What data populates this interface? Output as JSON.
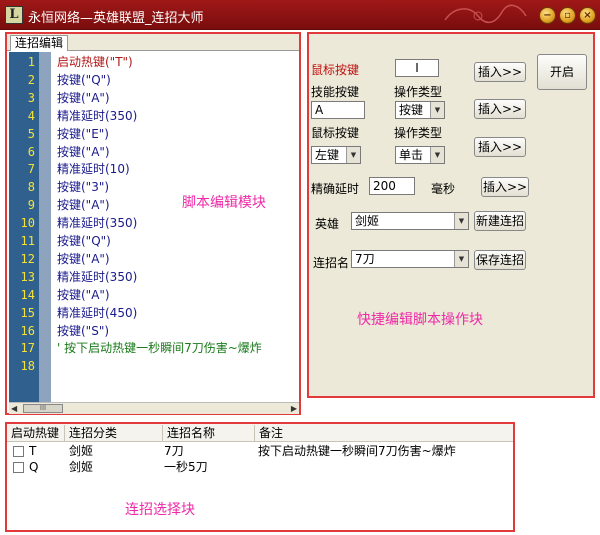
{
  "window": {
    "logo_letter": "L",
    "title": "永恒网络—英雄联盟_连招大师",
    "minimize_glyph": "−",
    "maximize_glyph": "▫",
    "close_glyph": "×",
    "titlebar_color": "#8f1212"
  },
  "editor": {
    "tab_label": "连招编辑",
    "annotation": "脚本编辑模块",
    "line_numbers": [
      "1",
      "2",
      "3",
      "4",
      "5",
      "6",
      "7",
      "8",
      "9",
      "10",
      "11",
      "12",
      "13",
      "14",
      "15",
      "16",
      "17",
      "18"
    ],
    "lines": [
      "启动热键(\"T\")",
      "按键(\"Q\")",
      "按键(\"A\")",
      "精准延时(350)",
      "按键(\"E\")",
      "按键(\"A\")",
      "精准延时(10)",
      "按键(\"3\")",
      "按键(\"A\")",
      "精准延时(350)",
      "按键(\"Q\")",
      "按键(\"A\")",
      "精准延时(350)",
      "按键(\"A\")",
      "精准延时(450)",
      "按键(\"S\")",
      "' 按下启动热键一秒瞬间7刀伤害~爆炸",
      ""
    ],
    "scroll_left": "◀",
    "scroll_right": "▶",
    "scroll_thumb": "III"
  },
  "quick": {
    "annotation": "快捷编辑脚本操作块",
    "mouse_key_label": "鼠标按键",
    "mouse_key_value": "I",
    "insert_label": "插入>>",
    "start_label": "开启",
    "skill_key_label": "技能按键",
    "op_type_label": "操作类型",
    "skill_key_value": "A",
    "op_type_value": "按键",
    "mouse_key_label2": "鼠标按键",
    "op_type_label2": "操作类型",
    "mouse_button_value": "左键",
    "click_type_value": "单击",
    "delay_label": "精确延时",
    "delay_value": "200",
    "delay_unit": "毫秒",
    "hero_label": "英雄",
    "hero_value": "剑姬",
    "new_combo_label": "新建连招",
    "combo_name_label": "连招名",
    "combo_name_value": "7刀",
    "save_combo_label": "保存连招"
  },
  "combos": {
    "annotation": "连招选择块",
    "headers": [
      "启动热键",
      "连招分类",
      "连招名称",
      "备注"
    ],
    "rows": [
      {
        "hotkey": "T",
        "category": "剑姬",
        "name": "7刀",
        "note": "按下启动热键一秒瞬间7刀伤害~爆炸"
      },
      {
        "hotkey": "Q",
        "category": "剑姬",
        "name": "一秒5刀",
        "note": ""
      }
    ]
  }
}
